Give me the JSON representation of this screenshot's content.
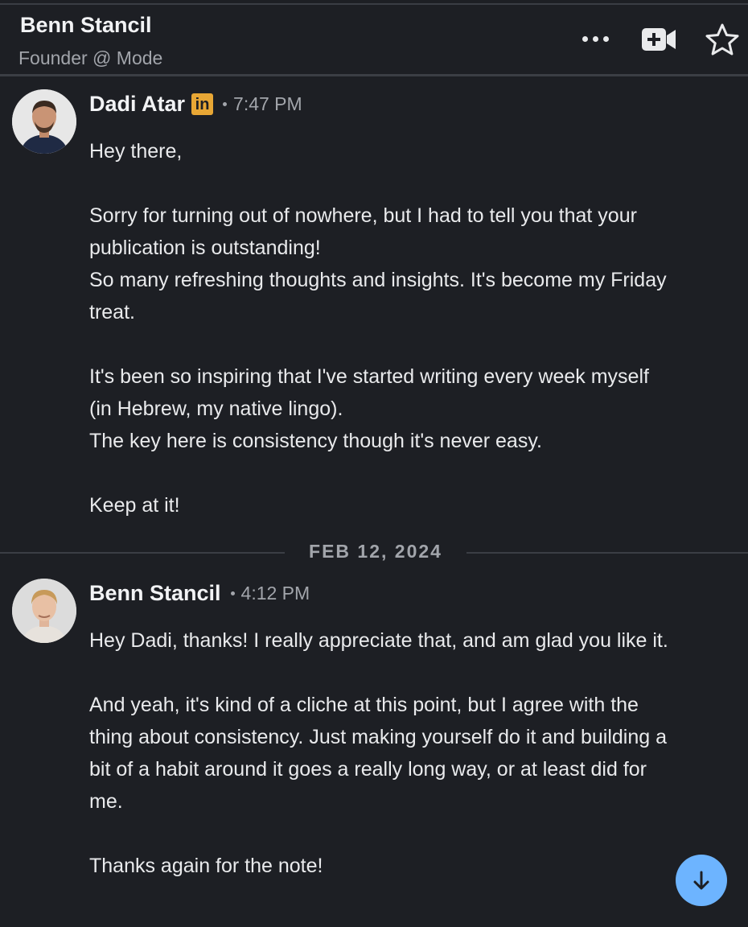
{
  "conversation_header": {
    "name": "Benn Stancil",
    "subtitle": "Founder @ Mode",
    "actions": {
      "more_icon": "more-horizontal-icon",
      "video_icon": "video-call-icon",
      "star_icon": "star-outline-icon"
    }
  },
  "messages": [
    {
      "sender": "Dadi Atar",
      "badge": "in",
      "badge_color": "#e8a735",
      "time": "7:47 PM",
      "paragraphs": [
        "Hey there,",
        "Sorry for turning out of nowhere, but I had to tell you that your publication is outstanding!\nSo many refreshing thoughts and insights. It's become my Friday treat.",
        " It's been so inspiring that I've started writing every week myself (in Hebrew, my native lingo).\nThe key here is consistency though it's never easy.",
        "Keep at it!"
      ]
    },
    {
      "sender": "Benn Stancil",
      "time": "4:12 PM",
      "paragraphs": [
        "Hey Dadi, thanks! I really appreciate that, and am glad you like it.",
        "And yeah, it's kind of a cliche at this point, but I agree with the thing about consistency. Just making yourself do it and building a bit of a habit around it goes a really long way, or at least did for me.",
        "Thanks again for the note!"
      ]
    }
  ],
  "date_separator": "FEB 12, 2024",
  "scroll_button": {
    "icon": "arrow-down-icon",
    "color": "#6db4ff"
  }
}
